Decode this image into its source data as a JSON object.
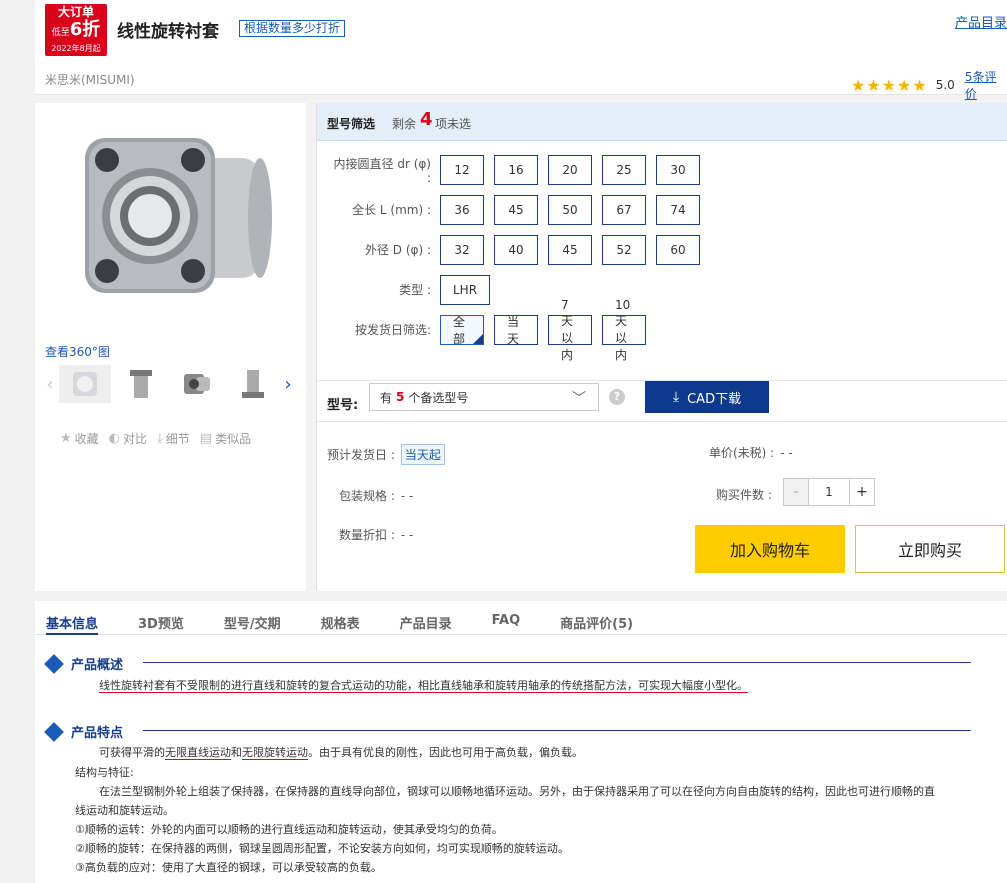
{
  "header": {
    "badge": {
      "line1": "大订单",
      "line2_small": "低至",
      "line2": "6折",
      "line3": "2022年8月起"
    },
    "title": "线性旋转衬套",
    "discount_tag": "根据数量多少打折",
    "catalog_link": "产品目录",
    "brand": "米思米(MISUMI)",
    "rating": {
      "stars": 5,
      "score": "5.0",
      "reviews": "5条评价"
    }
  },
  "gallery": {
    "view360": "查看360°图",
    "actions": [
      {
        "icon": "star-icon",
        "label": "收藏"
      },
      {
        "icon": "compare-icon",
        "label": "对比"
      },
      {
        "icon": "download-icon",
        "label": "细节"
      },
      {
        "icon": "similar-icon",
        "label": "类似品"
      }
    ]
  },
  "filter": {
    "title": "型号筛选",
    "remaining_prefix": "剩余",
    "remaining_count": "4",
    "remaining_suffix": "项未选",
    "rows": [
      {
        "label": "内接圆直径 dr (φ)",
        "label2": ":",
        "options": [
          "12",
          "16",
          "20",
          "25",
          "30"
        ]
      },
      {
        "label": "全长 L (mm) :",
        "options": [
          "36",
          "45",
          "50",
          "67",
          "74"
        ]
      },
      {
        "label": "外径 D (φ) :",
        "options": [
          "32",
          "40",
          "45",
          "52",
          "60"
        ]
      },
      {
        "label": "类型 :",
        "options": [
          "LHR"
        ]
      },
      {
        "label": "按发货日筛选:",
        "options": [
          "全部",
          "当天",
          "7天以内",
          "10天以内"
        ],
        "selected": 0
      }
    ]
  },
  "model": {
    "label": "型号:",
    "select_prefix": "有",
    "select_count": "5",
    "select_suffix": "个备选型号",
    "help": "?",
    "cad_button": "CAD下载"
  },
  "purchase": {
    "ship_label": "预计发货日 :",
    "ship_value": "当天起",
    "pack_label": "包装规格 :",
    "pack_value": "- -",
    "discount_label": "数量折扣 :",
    "discount_value": "- -",
    "price_label": "单价(未税) :",
    "price_value": "- -",
    "qty_label": "购买件数 :",
    "qty_minus": "-",
    "qty_value": "1",
    "qty_plus": "+",
    "cart_button": "加入购物车",
    "buy_button": "立即购买"
  },
  "tabs": [
    "基本信息",
    "3D预览",
    "型号/交期",
    "规格表",
    "产品目录",
    "FAQ",
    "商品评价(5)"
  ],
  "overview": {
    "title": "产品概述",
    "text": "线性旋转衬套有不受限制的进行直线和旋转的复合式运动的功能，相比直线轴承和旋转用轴承的传统搭配方法，可实现大幅度小型化。"
  },
  "features": {
    "title": "产品特点",
    "line1_a": "可获得平滑的",
    "line1_b": "无限直线运动",
    "line1_c": "和",
    "line1_d": "无限旋转运动",
    "line1_e": "。由于具有优良的刚性，因此也可用于高负载，偏负载。",
    "line2": "结构与特征:",
    "line3": "在法兰型钢制外轮上组装了保持器，在保持器的直线导向部位，钢球可以顺畅地循环运动。另外，由于保持器采用了可以在径向方向自由旋转的结构，因此也可进行顺畅的直",
    "line4": "线运动和旋转运动。",
    "line5": "①顺畅的运转：外轮的内面可以顺畅的进行直线运动和旋转运动，使其承受均匀的负荷。",
    "line6": "②顺畅的旋转：在保持器的两侧，钢球呈圆周形配置，不论安装方向如何，均可实现顺畅的旋转运动。",
    "line7": "③高负载的应对：使用了大直径的钢球，可以承受较高的负载。"
  }
}
